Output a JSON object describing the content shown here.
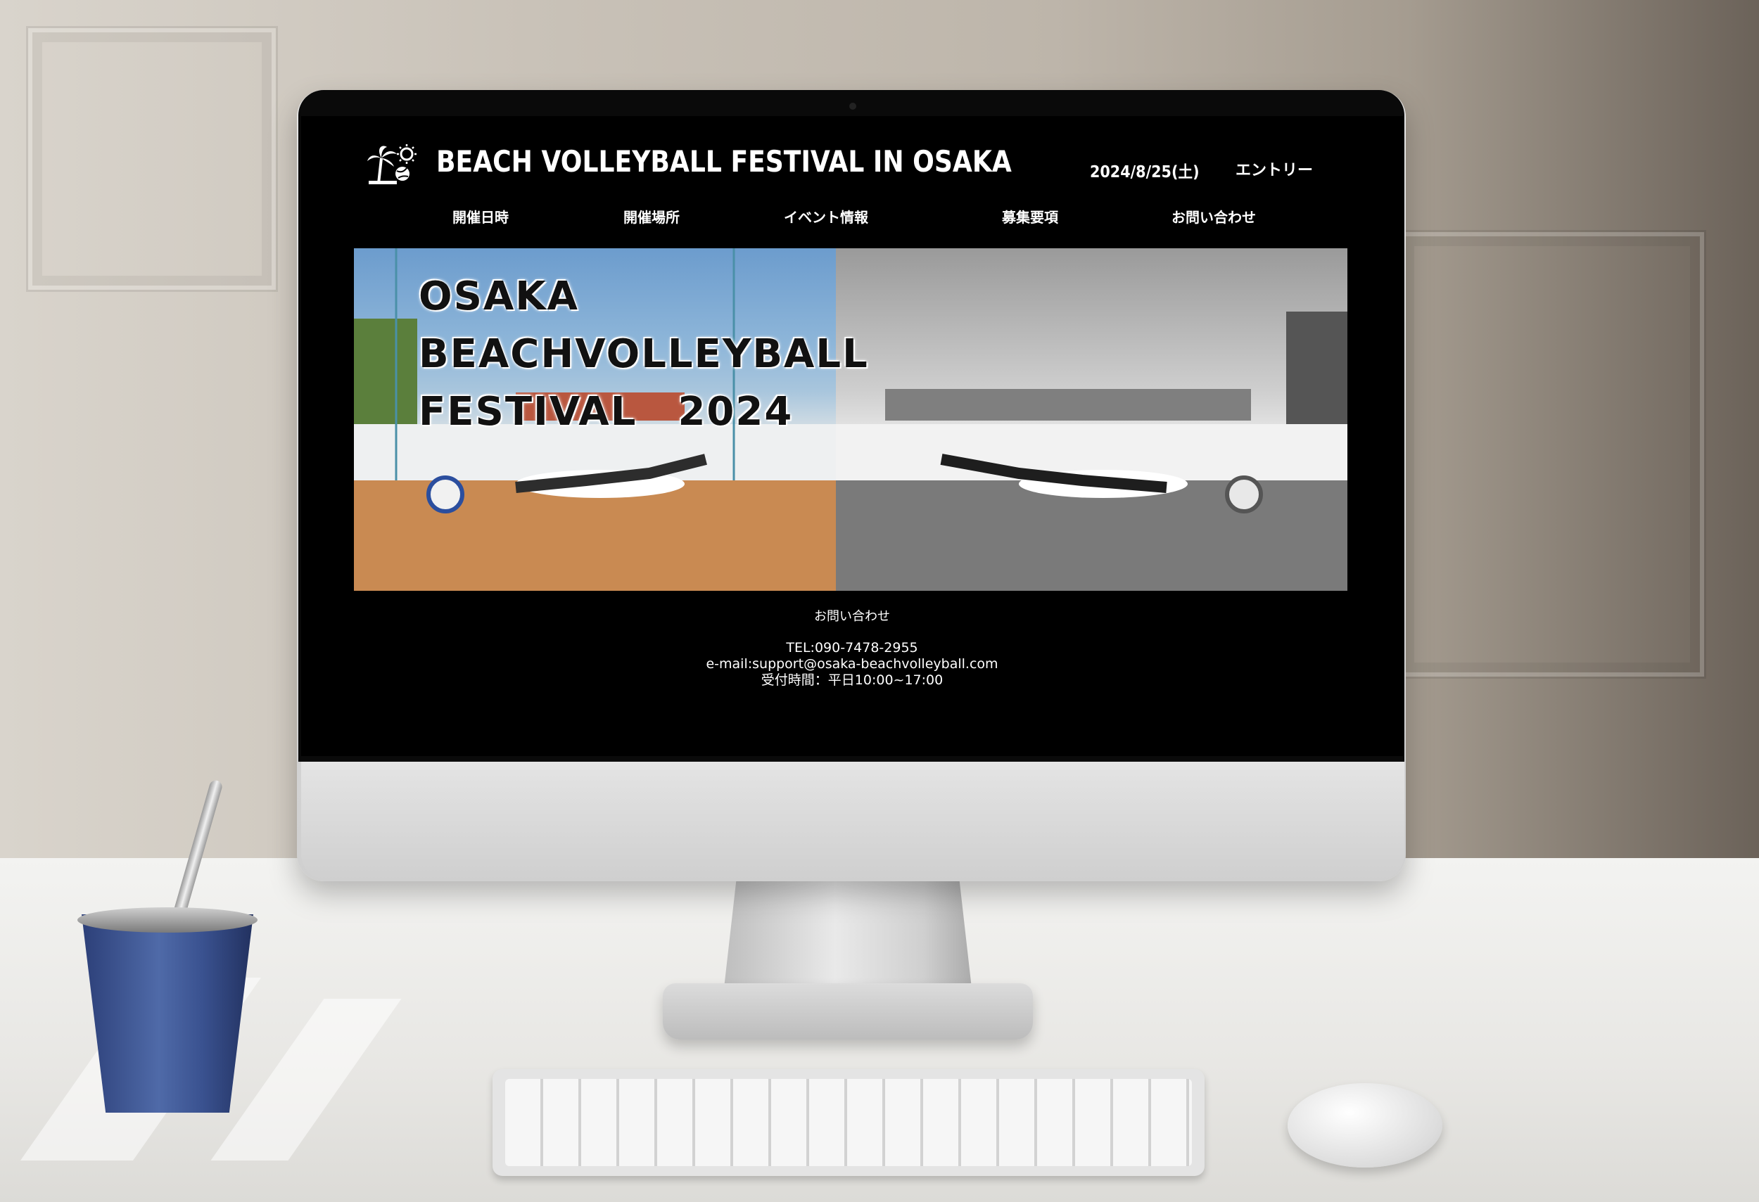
{
  "site": {
    "title": "BEACH VOLLEYBALL FESTIVAL IN OSAKA",
    "date": "2024/8/25(土)",
    "entry": "エントリー"
  },
  "nav": {
    "items": [
      {
        "label": "開催日時"
      },
      {
        "label": "開催場所"
      },
      {
        "label": "イベント情報"
      },
      {
        "label": "募集要項"
      },
      {
        "label": "お問い合わせ"
      }
    ]
  },
  "hero": {
    "line1": "OSAKA",
    "line2": "BEACHVOLLEYBALL",
    "line3": "FESTIVAL　2024"
  },
  "contact": {
    "heading": "お問い合わせ",
    "tel": "TEL:090-7478-2955",
    "email": "e-mail:support@osaka-beachvolleyball.com",
    "hours": "受付時間：平日10:00~17:00"
  },
  "icons": {
    "logo": "palm-tree-sun-ball-icon"
  }
}
